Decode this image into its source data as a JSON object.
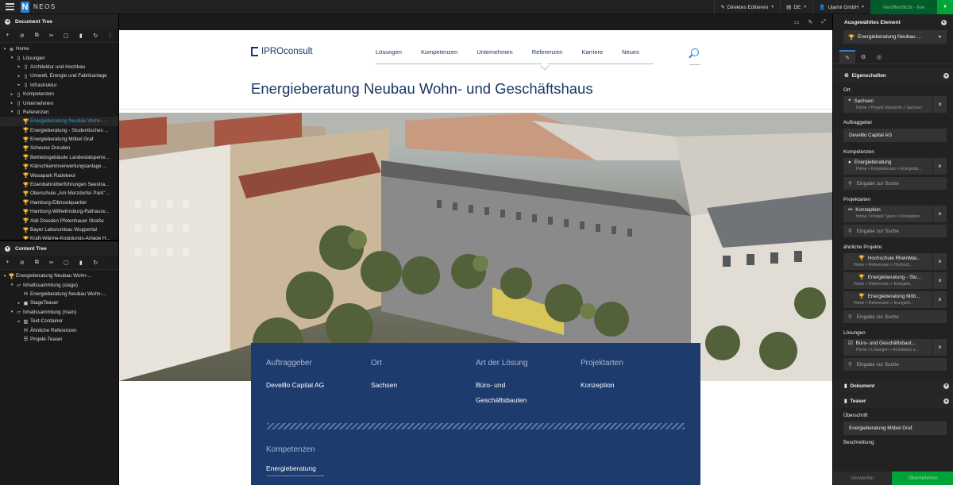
{
  "topbar": {
    "logo_letter": "N",
    "logo_text": "NEOS",
    "edit_mode": "Direktes Editieren",
    "language": "DE",
    "user": "Ujamii GmbH",
    "publish": "Veröffentlicht - live"
  },
  "document_tree": {
    "title": "Document Tree",
    "nodes": [
      {
        "label": "Home",
        "depth": 0,
        "icon": "globe-icon",
        "arrow": "▾"
      },
      {
        "label": "Lösungen",
        "depth": 1,
        "icon": "page-icon",
        "arrow": "▾"
      },
      {
        "label": "Architektur und Hochbau",
        "depth": 2,
        "icon": "page-icon",
        "arrow": "▸"
      },
      {
        "label": "Umwelt, Energie und Fabrikanlage",
        "depth": 2,
        "icon": "page-icon",
        "arrow": "▸"
      },
      {
        "label": "Infrastruktur",
        "depth": 2,
        "icon": "page-icon",
        "arrow": "▸"
      },
      {
        "label": "Kompetenzen",
        "depth": 1,
        "icon": "page-icon",
        "arrow": "▸"
      },
      {
        "label": "Unternehmen",
        "depth": 1,
        "icon": "page-icon",
        "arrow": "▸"
      },
      {
        "label": "Referenzen",
        "depth": 1,
        "icon": "page-icon",
        "arrow": "▾"
      },
      {
        "label": "Energieberatung Neubau Wohn-...",
        "depth": 2,
        "icon": "trophy-icon",
        "arrow": "",
        "active": true
      },
      {
        "label": "Energieberatung - Studentisches ...",
        "depth": 2,
        "icon": "trophy-icon",
        "arrow": ""
      },
      {
        "label": "Energieberatung Möbel Graf",
        "depth": 2,
        "icon": "trophy-icon",
        "arrow": ""
      },
      {
        "label": "Scheune Dresden",
        "depth": 2,
        "icon": "trophy-icon",
        "arrow": ""
      },
      {
        "label": "Betriebsgebäude Landestalsperre...",
        "depth": 2,
        "icon": "trophy-icon",
        "arrow": ""
      },
      {
        "label": "Klärschlammverwertungsanlage ...",
        "depth": 2,
        "icon": "trophy-icon",
        "arrow": ""
      },
      {
        "label": "Wasapark Radebeul",
        "depth": 2,
        "icon": "trophy-icon",
        "arrow": ""
      },
      {
        "label": "Eisenbahnüberführungen Seestra...",
        "depth": 2,
        "icon": "trophy-icon",
        "arrow": ""
      },
      {
        "label": "Oberschule „Am Merzdorfer Park\"...",
        "depth": 2,
        "icon": "trophy-icon",
        "arrow": ""
      },
      {
        "label": "Hamburg-Elbinselquartier",
        "depth": 2,
        "icon": "trophy-icon",
        "arrow": ""
      },
      {
        "label": "Hamburg-Wilhelmsburg-Rathausv...",
        "depth": 2,
        "icon": "trophy-icon",
        "arrow": ""
      },
      {
        "label": "Aldi Dresden Pfotenhauer Straße",
        "depth": 2,
        "icon": "trophy-icon",
        "arrow": ""
      },
      {
        "label": "Bayer Laborumbau Wuppertal",
        "depth": 2,
        "icon": "trophy-icon",
        "arrow": ""
      },
      {
        "label": "Kraft-Wärme-Kopplungs-Anlage H...",
        "depth": 2,
        "icon": "trophy-icon",
        "arrow": ""
      }
    ]
  },
  "content_tree": {
    "title": "Content Tree",
    "nodes": [
      {
        "label": "Energieberatung Neubau Wohn-...",
        "depth": 0,
        "icon": "trophy-icon",
        "arrow": "▾"
      },
      {
        "label": "Inhaltssammlung (stage)",
        "depth": 1,
        "icon": "folder-icon",
        "arrow": "▾"
      },
      {
        "label": "Energieberatung Neubau Wohn-...",
        "depth": 2,
        "icon": "heading-icon",
        "arrow": ""
      },
      {
        "label": "StageTeaser",
        "depth": 2,
        "icon": "image-icon",
        "arrow": "▸"
      },
      {
        "label": "Inhaltssammlung (main)",
        "depth": 1,
        "icon": "folder-icon",
        "arrow": "▾"
      },
      {
        "label": "Text-Container",
        "depth": 2,
        "icon": "columns-icon",
        "arrow": "▸"
      },
      {
        "label": "Ähnliche Referenzen",
        "depth": 2,
        "icon": "heading-icon",
        "arrow": ""
      },
      {
        "label": "Projekt-Teaser",
        "depth": 2,
        "icon": "list-icon",
        "arrow": ""
      }
    ]
  },
  "page": {
    "logo": "IPROconsult",
    "nav": [
      "Lösungen",
      "Kompetenzen",
      "Unternehmen",
      "Referenzen",
      "Karriere",
      "Neues"
    ],
    "title": "Energieberatung Neubau Wohn- und Geschäftshaus",
    "info": {
      "auftraggeber_label": "Auftraggeber",
      "auftraggeber": "Develllo Capital AG",
      "ort_label": "Ort",
      "ort": "Sachsen",
      "art_label": "Art der Lösung",
      "art_line1": "Büro- und",
      "art_line2": "Geschäftsbauten",
      "projektarten_label": "Projektarten",
      "projektarten": "Konzeption",
      "kompetenzen_label": "Kompetenzen",
      "kompetenzen": "Energieberatung"
    }
  },
  "inspector": {
    "header": "Ausgewähltes Element",
    "selected": "Energieberatung Neubau ...",
    "section_props": "Eigenschaften",
    "ort_label": "Ort",
    "ort_value": "Sachsen",
    "ort_path": "Home > Projekt Standorte > Sachsen",
    "auftraggeber_label": "Auftraggeber",
    "auftraggeber_value": "Develllo Capital AG",
    "kompetenzen_label": "Kompetenzen",
    "kompetenzen_value": "Energieberatung",
    "kompetenzen_path": "Home > Kompetenzen > Energiebe...",
    "search_placeholder": "Eingabe zur Suche",
    "projektarten_label": "Projektarten",
    "projektarten_value": "Konzeption",
    "projektarten_path": "Home > Projekt Typen > Konzeption",
    "aehnliche_label": "ähnliche Projekte",
    "aehnliche": [
      {
        "title": "Hochschule RheinMai...",
        "path": "Home > Referenzen > Hochsch..."
      },
      {
        "title": "Energieberatung - Stu...",
        "path": "Home > Referenzen > Energieb..."
      },
      {
        "title": "Energieberatung Möb...",
        "path": "Home > Referenzen > Energieb..."
      }
    ],
    "loesungen_label": "Lösungen",
    "loesungen_value": "Büro- und Geschäftsbaut...",
    "loesungen_path": "Home > Lösungen > Architektur u...",
    "section_dokument": "Dokument",
    "section_teaser": "Teaser",
    "ueberschrift_label": "Überschrift",
    "ueberschrift_value": "Energieberatung Möbel Graf",
    "beschreibung_label": "Beschreibung",
    "discard": "Verwerfen",
    "apply": "Übernehmen"
  }
}
